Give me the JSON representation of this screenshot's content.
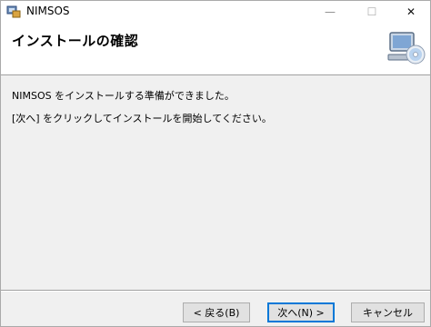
{
  "window": {
    "title": "NIMSOS",
    "controls": {
      "minimize": "—",
      "maximize": "☐",
      "close": "✕"
    }
  },
  "header": {
    "title": "インストールの確認",
    "graphic": "computer-disc-icon"
  },
  "content": {
    "line1": "NIMSOS をインストールする準備ができました。",
    "line2": "[次へ] をクリックしてインストールを開始してください。"
  },
  "buttons": {
    "back": "< 戻る(B)",
    "next": "次へ(N) >",
    "cancel": "キャンセル"
  },
  "colors": {
    "accent": "#0078d7",
    "background": "#f0f0f0",
    "header_background": "#ffffff"
  }
}
